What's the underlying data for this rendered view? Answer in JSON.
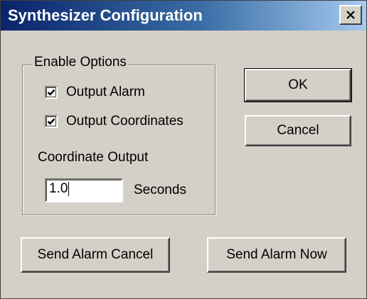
{
  "window": {
    "title": "Synthesizer Configuration",
    "close_icon": "close-icon"
  },
  "enable_options": {
    "legend": "Enable Options",
    "output_alarm": {
      "label": "Output Alarm",
      "checked": true
    },
    "output_coordinates": {
      "label": "Output Coordinates",
      "checked": true
    },
    "coordinate_output_label": "Coordinate Output",
    "coordinate_output_value": "1.0",
    "seconds_label": "Seconds"
  },
  "buttons": {
    "ok": "OK",
    "cancel": "Cancel",
    "send_alarm_cancel": "Send Alarm Cancel",
    "send_alarm_now": "Send Alarm Now"
  },
  "colors": {
    "face": "#d4d0c8",
    "title_start": "#0a246a",
    "title_end": "#a6caf0"
  }
}
